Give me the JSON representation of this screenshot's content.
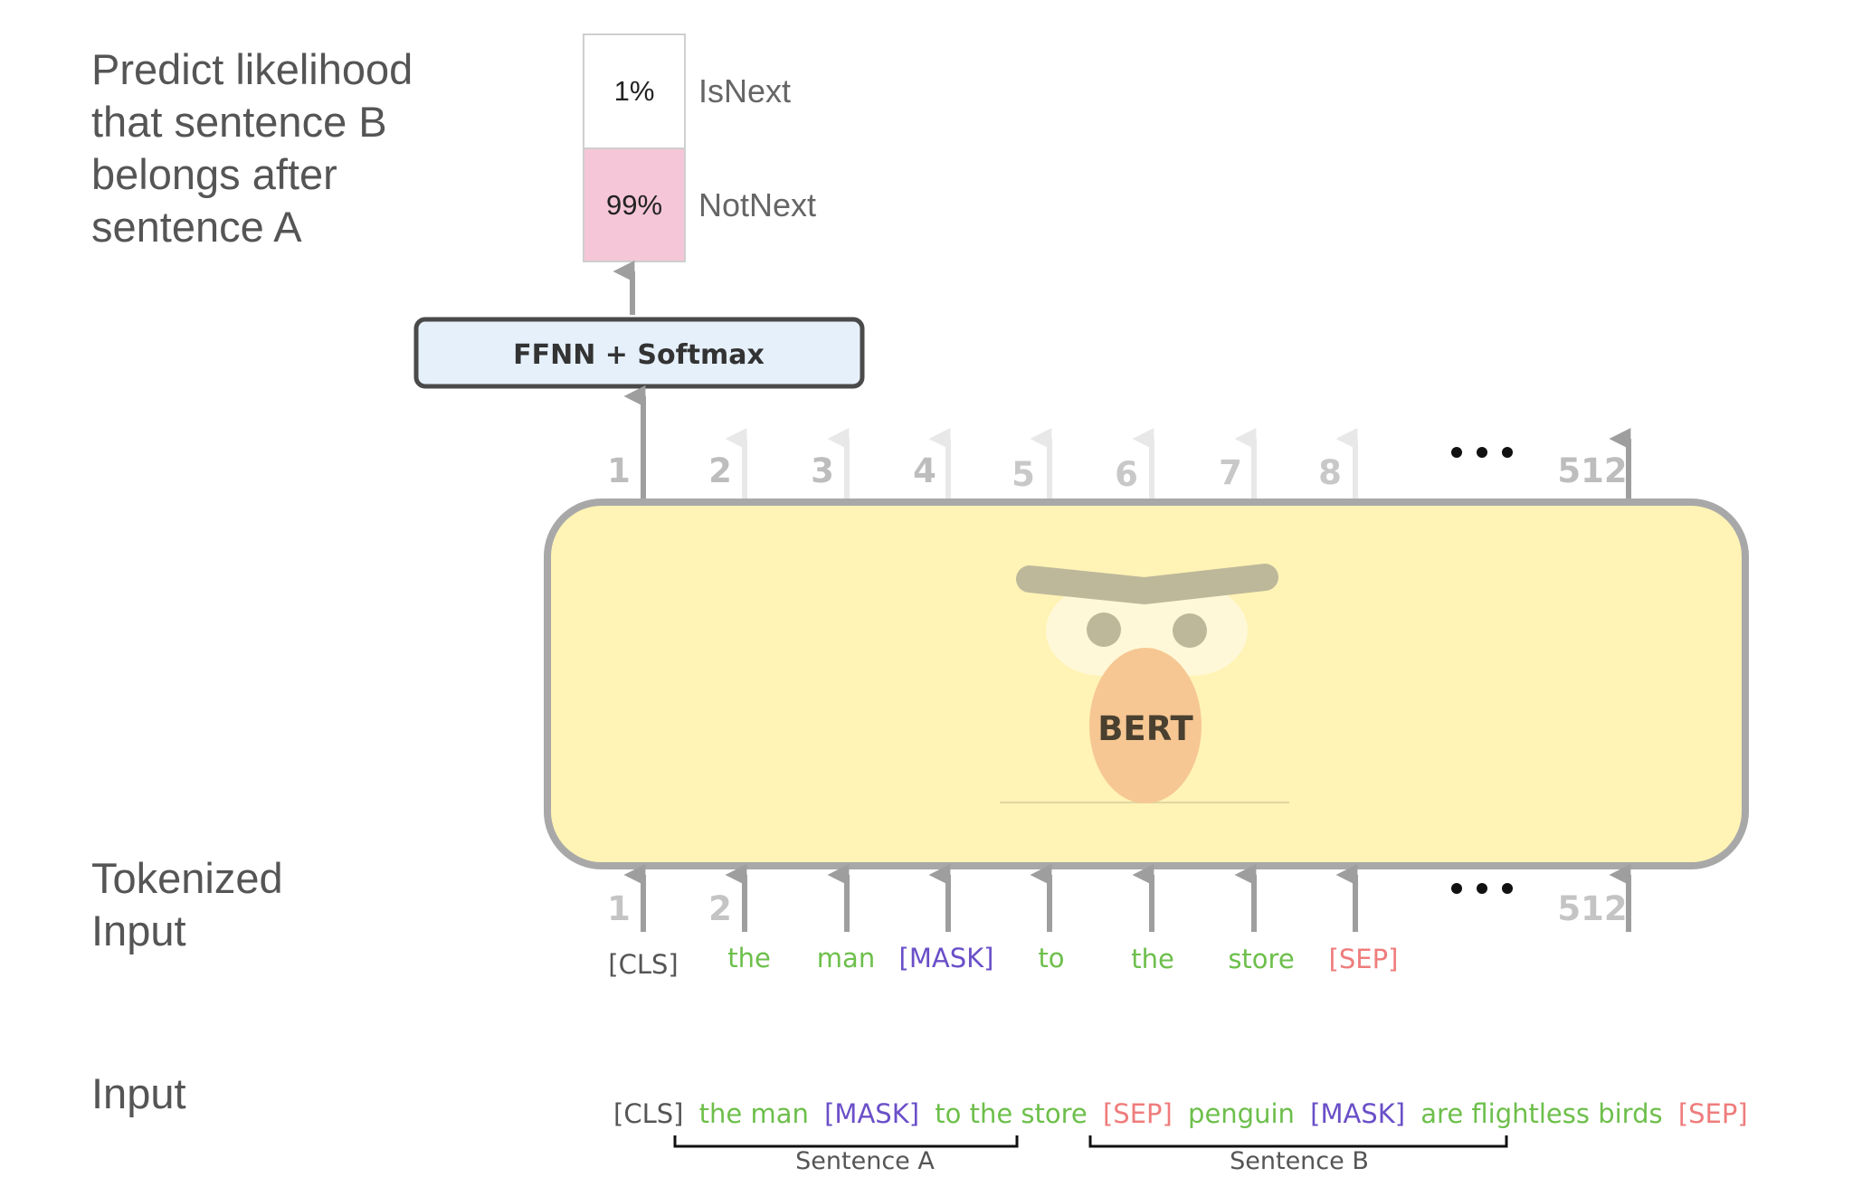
{
  "labels": {
    "predict": [
      "Predict likelihood",
      "that sentence B",
      "belongs after",
      "sentence A"
    ],
    "tokenized": [
      "Tokenized",
      "Input"
    ],
    "input": "Input"
  },
  "classifier": {
    "is_next_pct": "1%",
    "is_next_label": "IsNext",
    "not_next_pct": "99%",
    "not_next_label": "NotNext"
  },
  "ffnn_label": "FFNN + Softmax",
  "model_label": "BERT",
  "output_positions": [
    "1",
    "2",
    "3",
    "4",
    "5",
    "6",
    "7",
    "8",
    "512"
  ],
  "input_positions": [
    "1",
    "2",
    "512"
  ],
  "ellipsis": "•••",
  "tokens": [
    {
      "text": "[CLS]",
      "color": "#555555"
    },
    {
      "text": "the",
      "color": "#6dbf4b"
    },
    {
      "text": "man",
      "color": "#6dbf4b"
    },
    {
      "text": "[MASK]",
      "color": "#6a4fc8"
    },
    {
      "text": "to",
      "color": "#6dbf4b"
    },
    {
      "text": "the",
      "color": "#6dbf4b"
    },
    {
      "text": "store",
      "color": "#6dbf4b"
    },
    {
      "text": "[SEP]",
      "color": "#ef7c7c"
    }
  ],
  "input_sentence": [
    {
      "text": "[CLS]",
      "color": "#555555"
    },
    {
      "text": "the man",
      "color": "#6dbf4b"
    },
    {
      "text": "[MASK]",
      "color": "#6a4fc8"
    },
    {
      "text": "to the store",
      "color": "#6dbf4b"
    },
    {
      "text": "[SEP]",
      "color": "#ef7c7c"
    },
    {
      "text": "penguin",
      "color": "#6dbf4b"
    },
    {
      "text": "[MASK]",
      "color": "#6a4fc8"
    },
    {
      "text": "are flightless birds",
      "color": "#6dbf4b"
    },
    {
      "text": "[SEP]",
      "color": "#ef7c7c"
    }
  ],
  "sentence_a_label": "Sentence A",
  "sentence_b_label": "Sentence B",
  "colors": {
    "bert_fill": "#fff3b5",
    "ffnn_fill": "#e6f0fb",
    "not_next_fill": "#f5c6d7",
    "arrow": "#9e9e9e",
    "arrow_light": "#e8e8e8"
  }
}
